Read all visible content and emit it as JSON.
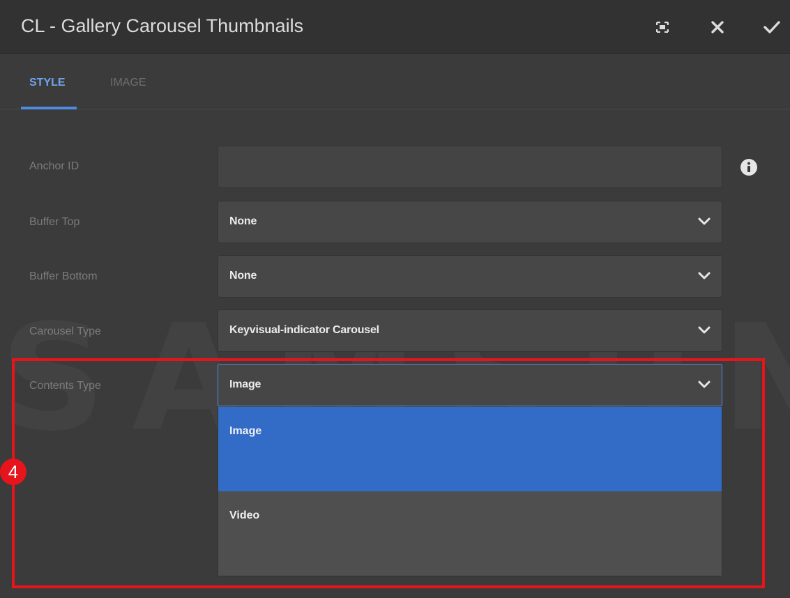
{
  "dialog": {
    "title": "CL - Gallery Carousel Thumbnails",
    "buttons": {
      "fullscreen_icon": "fullscreen-icon",
      "close_icon": "close-icon",
      "confirm_icon": "checkmark-icon"
    }
  },
  "tabs": [
    {
      "label": "STYLE",
      "active": true
    },
    {
      "label": "IMAGE",
      "active": false
    }
  ],
  "form": {
    "anchor_id": {
      "label": "Anchor ID",
      "value": "",
      "info_icon": "info-icon"
    },
    "buffer_top": {
      "label": "Buffer Top",
      "value": "None"
    },
    "buffer_bottom": {
      "label": "Buffer Bottom",
      "value": "None"
    },
    "carousel_type": {
      "label": "Carousel Type",
      "value": "Keyvisual-indicator Carousel"
    },
    "contents_type": {
      "label": "Contents Type",
      "value": "Image",
      "options": [
        {
          "label": "Image",
          "selected": true
        },
        {
          "label": "Video",
          "selected": false
        }
      ]
    }
  },
  "annotation": {
    "step": "4",
    "color": "#e8141b"
  },
  "watermark": "SAMSUNG",
  "colors": {
    "accent": "#4f8be0",
    "selected_option": "#326cc7",
    "header_bg": "#323232",
    "dialog_bg": "#3b3b3b"
  }
}
